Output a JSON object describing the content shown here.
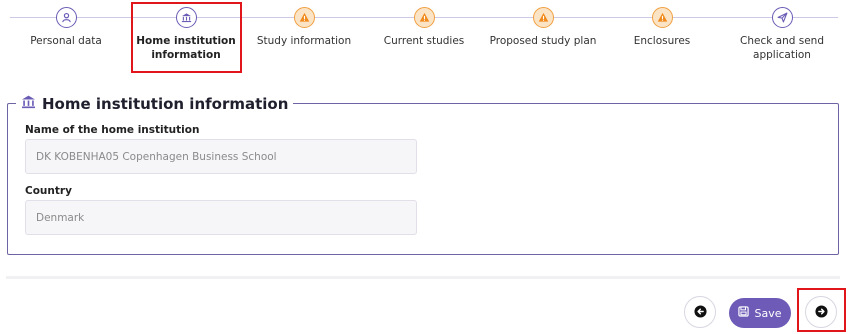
{
  "stepper": {
    "steps": [
      {
        "label": "Personal data",
        "icon": "person-icon",
        "state": "done"
      },
      {
        "label": "Home institution information",
        "icon": "institution-icon",
        "state": "current"
      },
      {
        "label": "Study information",
        "icon": "warning-icon",
        "state": "warning"
      },
      {
        "label": "Current studies",
        "icon": "warning-icon",
        "state": "warning"
      },
      {
        "label": "Proposed study plan",
        "icon": "warning-icon",
        "state": "warning"
      },
      {
        "label": "Enclosures",
        "icon": "warning-icon",
        "state": "warning"
      },
      {
        "label": "Check and send application",
        "icon": "send-icon",
        "state": "pending"
      }
    ]
  },
  "panel": {
    "title": "Home institution information",
    "icon": "institution-icon",
    "fields": [
      {
        "label": "Name of the home institution",
        "value": "DK KOBENHA05 Copenhagen Business School"
      },
      {
        "label": "Country",
        "value": "Denmark"
      }
    ]
  },
  "actions": {
    "back_icon": "arrow-left-icon",
    "save_label": "Save",
    "save_icon": "floppy-disk-icon",
    "next_icon": "arrow-right-icon"
  },
  "colors": {
    "accent": "#6e5bb7",
    "warning": "#f0a041",
    "highlight": "#e0161b"
  }
}
